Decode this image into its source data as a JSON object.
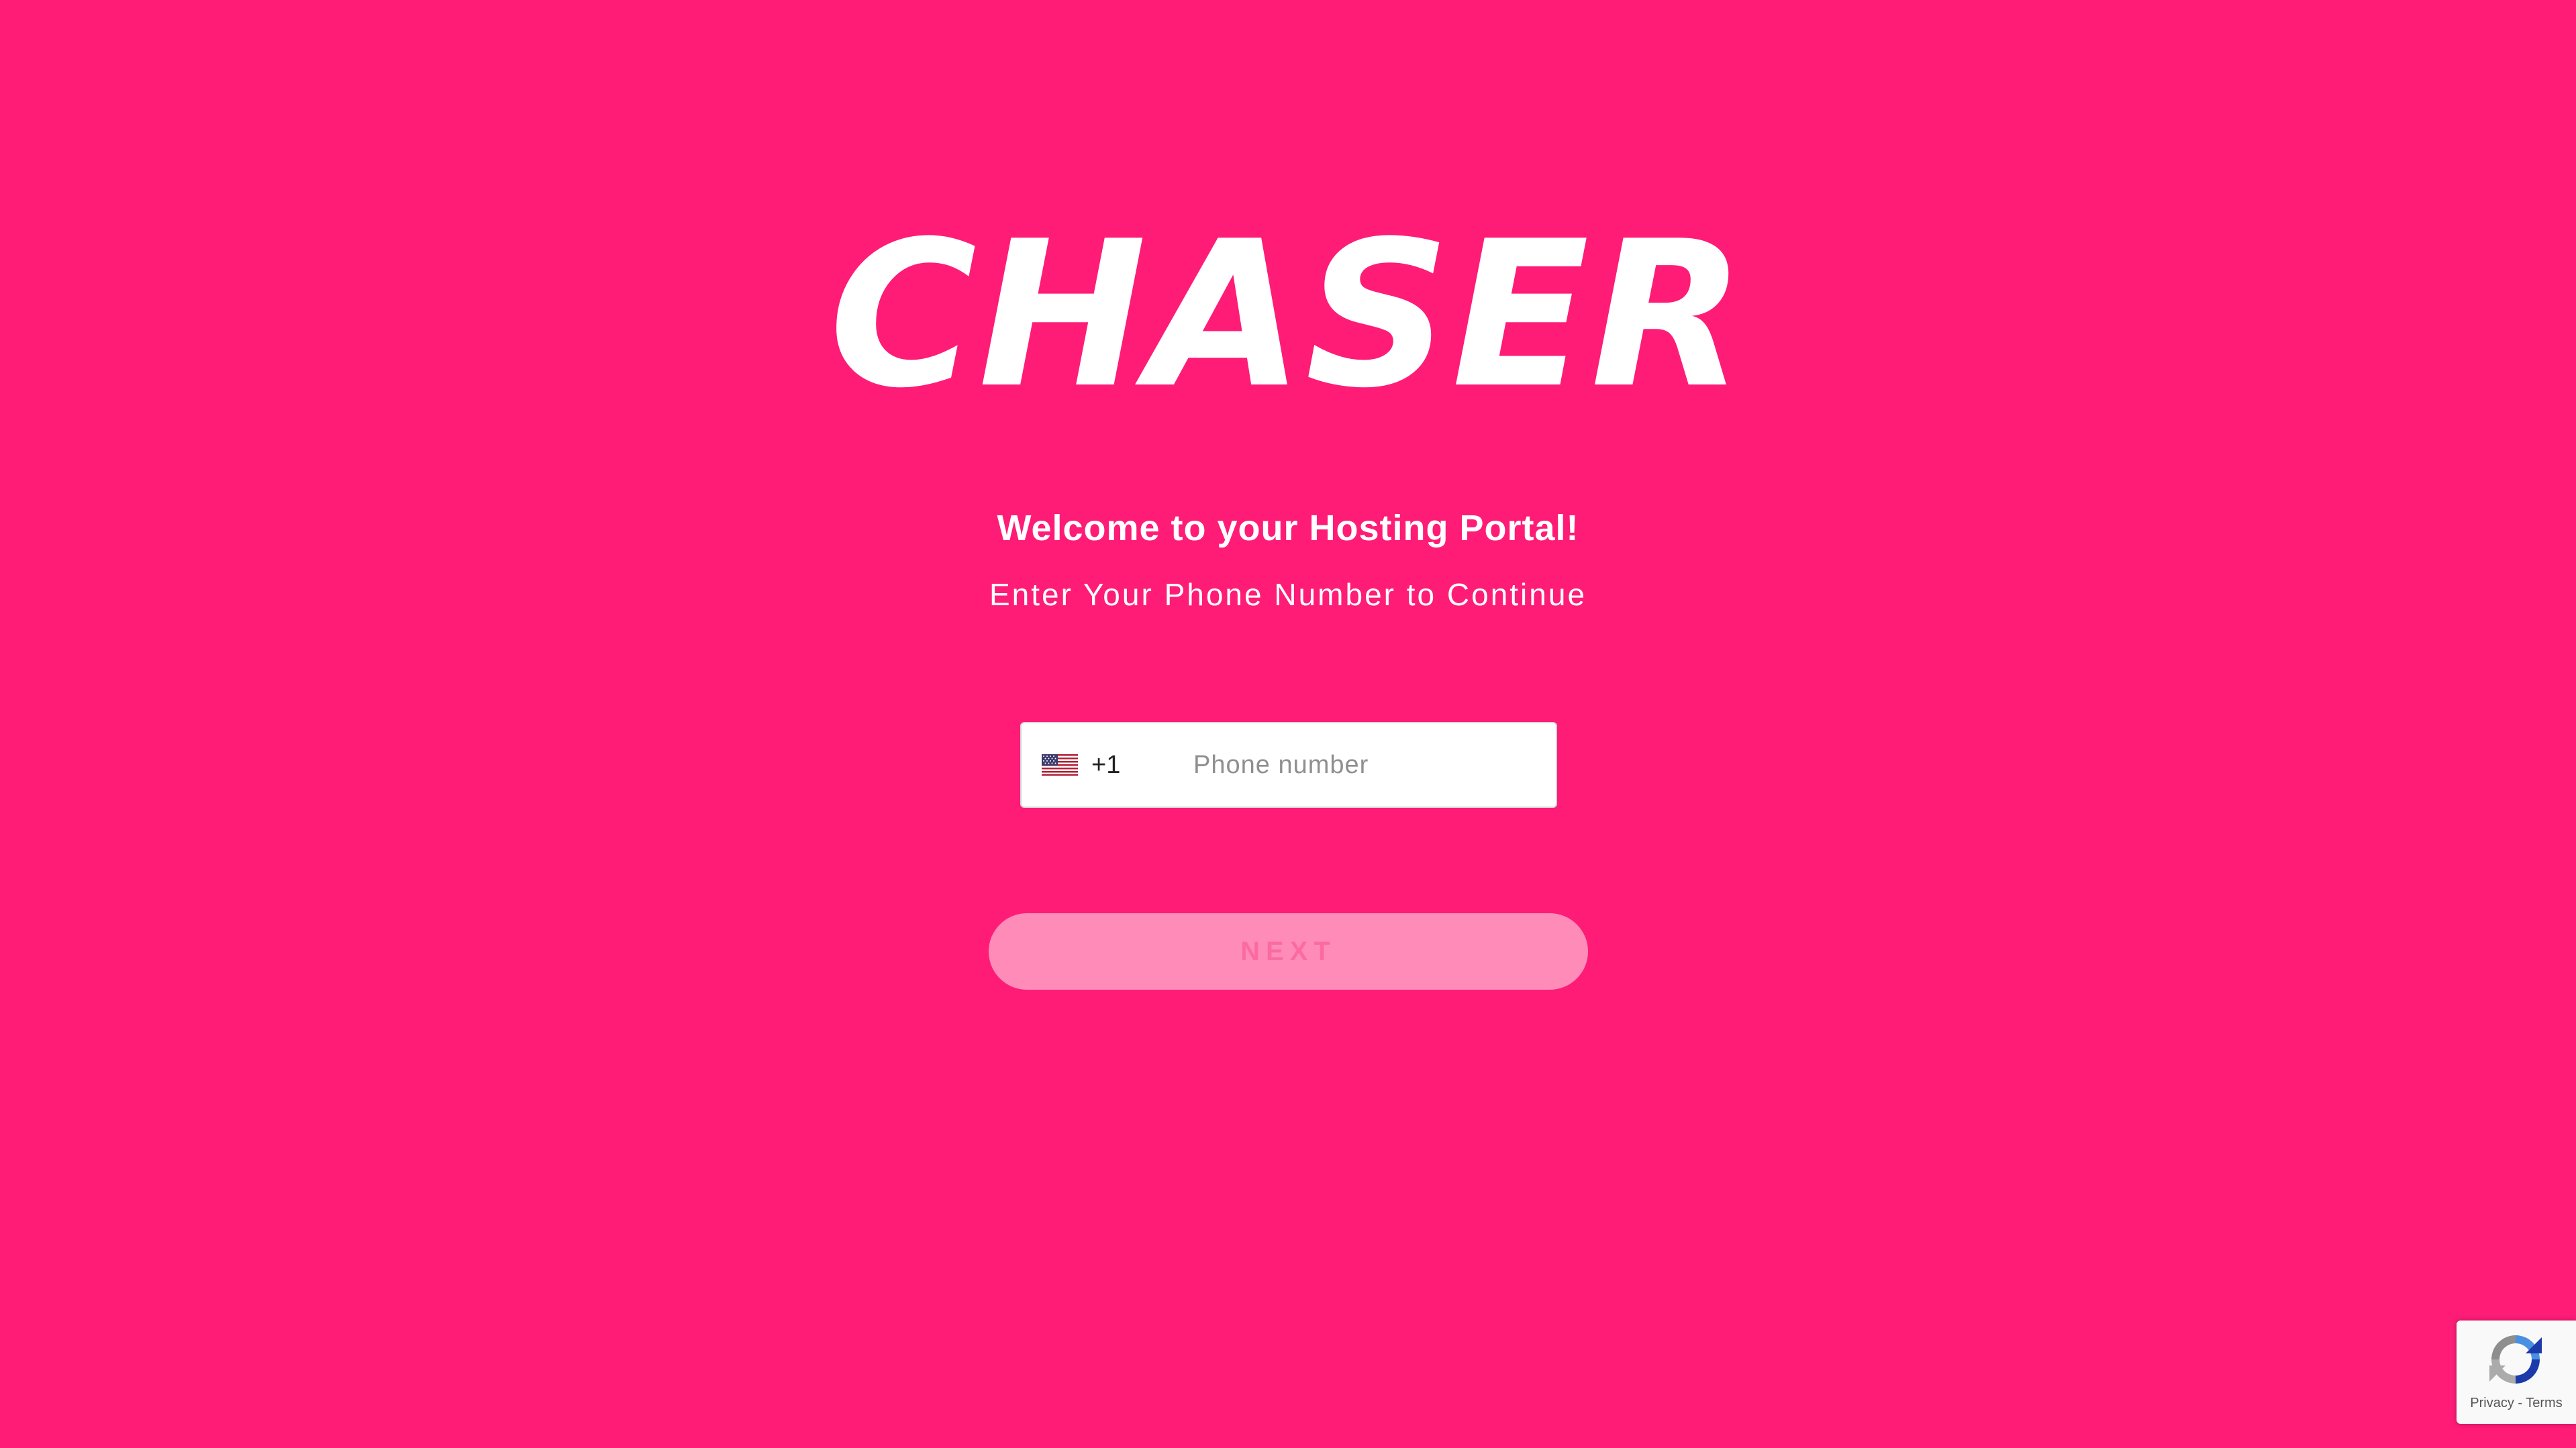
{
  "brand": {
    "logo_text": "CHASER",
    "background_color": "#fe1c77"
  },
  "welcome": {
    "title": "Welcome to your Hosting Portal!",
    "subtitle": "Enter Your Phone Number to Continue"
  },
  "phone": {
    "country_flag": "us-flag-icon",
    "dial_code": "+1",
    "value": "",
    "placeholder": "Phone number"
  },
  "next_button": {
    "label": "NEXT",
    "state": "disabled"
  },
  "recaptcha": {
    "icon": "recaptcha-icon",
    "privacy_label": "Privacy",
    "separator": " - ",
    "terms_label": "Terms"
  }
}
